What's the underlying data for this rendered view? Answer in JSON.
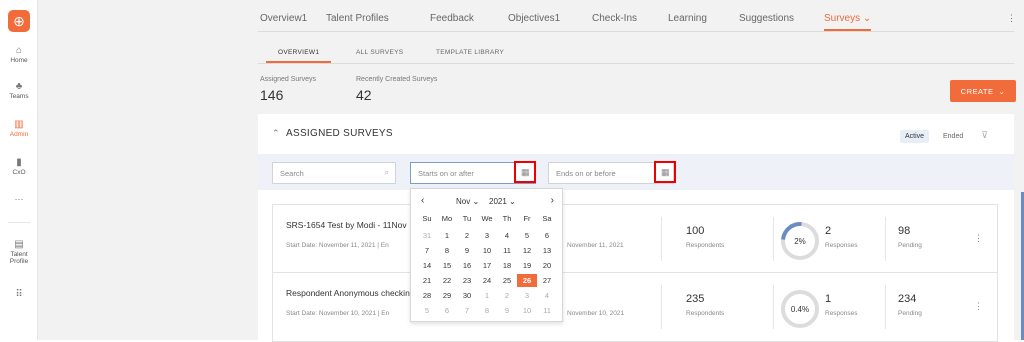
{
  "sidebar": {
    "logo_glyph": "⊕",
    "items": [
      {
        "label": "Home",
        "icon": "home-icon",
        "glyph": "⌂"
      },
      {
        "label": "Teams",
        "icon": "teams-icon",
        "glyph": "♣"
      },
      {
        "label": "Admin",
        "icon": "admin-icon",
        "glyph": "▥"
      },
      {
        "label": "CxO",
        "icon": "chart-icon",
        "glyph": "▮"
      },
      {
        "label": "···",
        "icon": "more-icon",
        "glyph": ""
      },
      {
        "label1": "Talent",
        "label2": "Profile",
        "icon": "talent-profile-icon",
        "glyph": "▤"
      },
      {
        "label": "",
        "icon": "grid-icon",
        "glyph": "⠿"
      }
    ]
  },
  "topnav": {
    "tabs": [
      "Overview1",
      "Talent Profiles",
      "Feedback",
      "Objectives1",
      "Check-Ins",
      "Learning",
      "Suggestions",
      "Surveys"
    ],
    "active": "Surveys",
    "chevron": "⌄"
  },
  "subtabs": [
    "OVERVIEW1",
    "ALL SURVEYS",
    "TEMPLATE LIBRARY"
  ],
  "stats": [
    {
      "label": "Assigned Surveys",
      "value": "146"
    },
    {
      "label": "Recently Created Surveys",
      "value": "42"
    }
  ],
  "create_button": {
    "label": "CREATE",
    "chevron": "⌄"
  },
  "panel": {
    "title": "ASSIGNED SURVEYS",
    "chevron": "⌃",
    "filters": [
      "Active",
      "Ended"
    ],
    "filter_icon_glyph": "⊽",
    "search_placeholder": "Search",
    "start_placeholder": "Starts on or after",
    "end_placeholder": "Ends on or before"
  },
  "calendar": {
    "month": "Nov",
    "year": "2021",
    "weekdays": [
      "Su",
      "Mo",
      "Tu",
      "We",
      "Th",
      "Fr",
      "Sa"
    ],
    "weeks": [
      [
        "31",
        "1",
        "2",
        "3",
        "4",
        "5",
        "6"
      ],
      [
        "7",
        "8",
        "9",
        "10",
        "11",
        "12",
        "13"
      ],
      [
        "14",
        "15",
        "16",
        "17",
        "18",
        "19",
        "20"
      ],
      [
        "21",
        "22",
        "23",
        "24",
        "25",
        "26",
        "27"
      ],
      [
        "28",
        "29",
        "30",
        "1",
        "2",
        "3",
        "4"
      ],
      [
        "5",
        "6",
        "7",
        "8",
        "9",
        "10",
        "11"
      ]
    ],
    "selected": "26"
  },
  "surveys": [
    {
      "title": "SRS-1654 Test by Modi - 11Nov",
      "start": "Start Date: November 11, 2021  |  En",
      "end": "November 11, 2021",
      "respondents": "100",
      "respondents_label": "Respondents",
      "percent": "2%",
      "responses": "2",
      "responses_label": "Responses",
      "pending": "98",
      "pending_label": "Pending"
    },
    {
      "title": "Respondent Anonymous checkin",
      "start": "Start Date: November 10, 2021  |  En",
      "end": "November 10, 2021",
      "respondents": "235",
      "respondents_label": "Respondents",
      "percent": "0.4%",
      "responses": "1",
      "responses_label": "Responses",
      "pending": "234",
      "pending_label": "Pending"
    }
  ],
  "colors": {
    "accent": "#f26b3a",
    "ring": "#6b8bc4"
  }
}
